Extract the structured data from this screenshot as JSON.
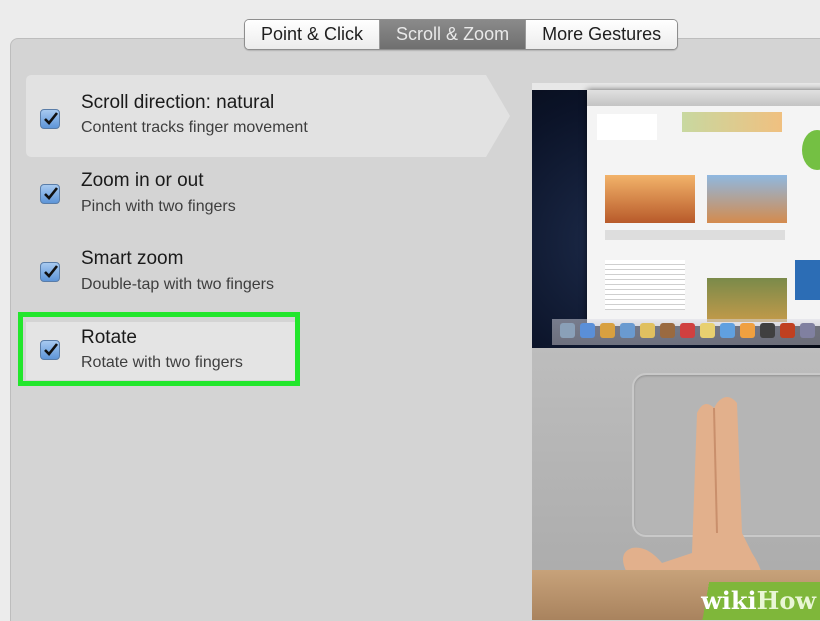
{
  "tabs": [
    {
      "label": "Point & Click",
      "active": false
    },
    {
      "label": "Scroll & Zoom",
      "active": true
    },
    {
      "label": "More Gestures",
      "active": false
    }
  ],
  "options": [
    {
      "title": "Scroll direction: natural",
      "subtitle": "Content tracks finger movement",
      "checked": true
    },
    {
      "title": "Zoom in or out",
      "subtitle": "Pinch with two fingers",
      "checked": true
    },
    {
      "title": "Smart zoom",
      "subtitle": "Double-tap with two fingers",
      "checked": true
    },
    {
      "title": "Rotate",
      "subtitle": "Rotate with two fingers",
      "checked": true
    }
  ],
  "highlight_color": "#22e62c",
  "accent_color": "#5e95d8",
  "watermark": {
    "part1": "wiki",
    "part2": "How"
  }
}
